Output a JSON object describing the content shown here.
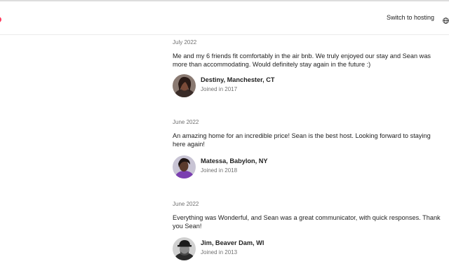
{
  "header": {
    "switch_to_hosting": "Switch to hosting",
    "globe_icon": "globe-icon",
    "brand_color": "#ff385c"
  },
  "reviews": [
    {
      "date": "July 2022",
      "text": "Me and my 6 friends fit comfortably in the air bnb. We truly enjoyed our stay and Sean was more than accommodating. Would definitely stay again in the future :)",
      "name": "Destiny, Manchester, CT",
      "joined": "Joined in 2017"
    },
    {
      "date": "June 2022",
      "text": "An amazing home for an incredible price! Sean is the best host. Looking forward to staying here again!",
      "name": "Matessa, Babylon, NY",
      "joined": "Joined in 2018"
    },
    {
      "date": "June 2022",
      "text": "Everything was Wonderful, and Sean was a great communicator, with quick responses. Thank you Sean!",
      "name": "Jim, Beaver Dam, WI",
      "joined": "Joined in 2013"
    }
  ]
}
